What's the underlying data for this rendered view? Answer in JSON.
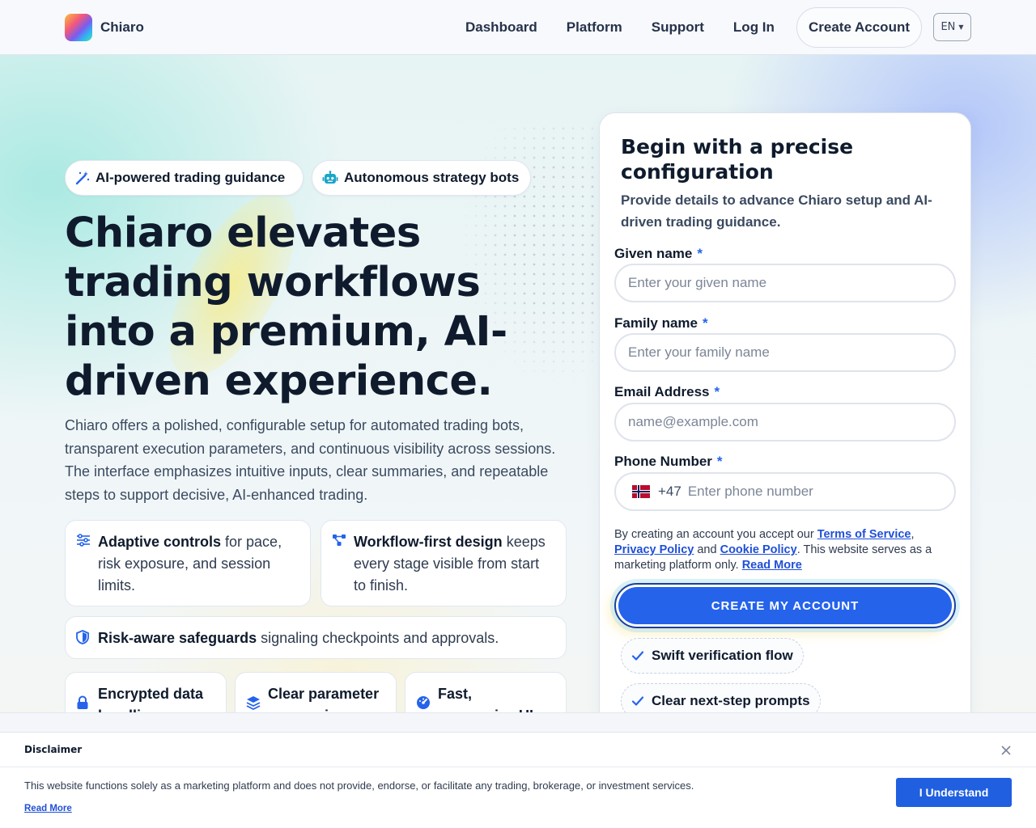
{
  "brand": {
    "name": "Chiaro"
  },
  "nav": {
    "items": [
      "Dashboard",
      "Platform",
      "Support",
      "Log In"
    ],
    "create_account": "Create Account",
    "language": "EN"
  },
  "hero": {
    "badges": [
      "AI-powered trading guidance",
      "Autonomous strategy bots"
    ],
    "title": "Chiaro elevates trading workflows into a premium, AI-driven experience.",
    "description": "Chiaro offers a polished, configurable setup for automated trading bots, transparent execution parameters, and continuous visibility across sessions. The interface emphasizes intuitive inputs, clear summaries, and repeatable steps to support decisive, AI-enhanced trading.",
    "features": [
      {
        "bold": "Adaptive controls",
        "rest": " for pace, risk exposure, and session limits."
      },
      {
        "bold": "Workflow-first design",
        "rest": " keeps every stage visible from start to finish."
      },
      {
        "bold": "Risk-aware safeguards",
        "rest": " signaling checkpoints and approvals."
      }
    ],
    "mini_features": [
      "Encrypted data handling",
      "Clear parameter summaries",
      "Fast, responsive UI"
    ]
  },
  "form": {
    "title": "Begin with a precise configuration",
    "subtitle": "Provide details to advance Chiaro setup and AI-driven trading guidance.",
    "given_name": {
      "label": "Given name",
      "placeholder": "Enter your given name",
      "value": ""
    },
    "family_name": {
      "label": "Family name",
      "placeholder": "Enter your family name",
      "value": ""
    },
    "email": {
      "label": "Email Address",
      "placeholder": "name@example.com",
      "value": ""
    },
    "phone": {
      "label": "Phone Number",
      "country_code": "+47",
      "placeholder": "Enter phone number",
      "value": ""
    },
    "required_mark": "*",
    "legal": {
      "p1": "By creating an account you accept our ",
      "terms": "Terms of Service",
      "p2": ", ",
      "privacy": "Privacy Policy",
      "p3": " and ",
      "cookie": "Cookie Policy",
      "p4": ". This website serves as a marketing platform only. ",
      "read_more": "Read More"
    },
    "submit": "CREATE MY ACCOUNT",
    "checks": [
      "Swift verification flow",
      "Clear next-step prompts"
    ]
  },
  "disclaimer": {
    "title": "Disclaimer",
    "text": "This website functions solely as a marketing platform and does not provide, endorse, or facilitate any trading, brokerage, or investment services.",
    "read_more": "Read More",
    "button": "I Understand"
  },
  "colors": {
    "accent": "#2563eb",
    "text": "#0f1b2d",
    "muted": "#3b4a60"
  }
}
